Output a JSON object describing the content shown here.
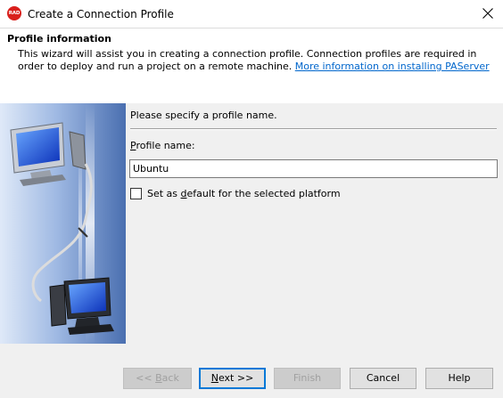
{
  "window": {
    "title": "Create a Connection Profile",
    "app_icon_text": "RAD"
  },
  "header": {
    "title": "Profile information",
    "description": "This wizard will assist you in creating a connection profile.  Connection profiles are required in order to deploy and run a project on a remote machine.",
    "link": "More information on installing PAServer"
  },
  "form": {
    "prompt": "Please specify a profile name.",
    "profile_label_mnemonic": "P",
    "profile_label_rest": "rofile name:",
    "profile_value": "Ubuntu",
    "default_label_before": "Set as ",
    "default_label_mnemonic": "d",
    "default_label_after": "efault for the selected platform",
    "default_checked": false
  },
  "buttons": {
    "back_before": "<< ",
    "back_mnemonic": "B",
    "back_after": "ack",
    "next_mnemonic": "N",
    "next_after": "ext >>",
    "finish": "Finish",
    "cancel": "Cancel",
    "help": "Help"
  },
  "colors": {
    "brand": "#d9201c",
    "link": "#0066cc",
    "focus": "#0078d7",
    "panel_dark": "#4a6fb0",
    "panel_light": "#dfe9f8"
  },
  "icons": {
    "app": "rad-studio-icon",
    "close": "close-icon",
    "side_image": "remote-computers-illustration"
  }
}
